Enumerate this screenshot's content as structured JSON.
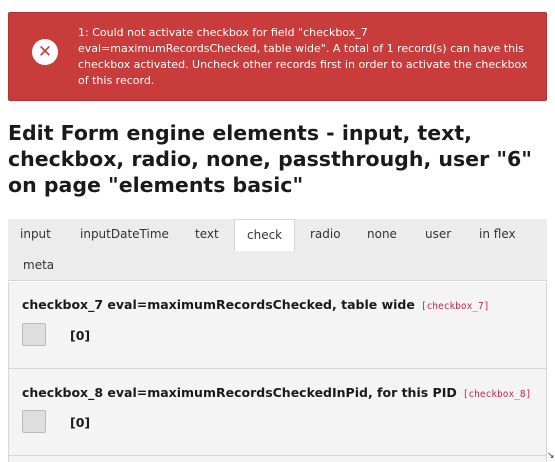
{
  "alert": {
    "icon": "close-circle-icon",
    "message": "1: Could not activate checkbox for field \"checkbox_7 eval=maximumRecordsChecked, table wide\". A total of 1 record(s) can have this checkbox activated. Uncheck other records first in order to activate the checkbox of this record.",
    "color": "#c83c3c"
  },
  "page_title": "Edit Form engine elements - input, text, checkbox, radio, none, passthrough, user \"6\" on page \"elements basic\"",
  "tabs": [
    {
      "label": "input"
    },
    {
      "label": "inputDateTime"
    },
    {
      "label": "text"
    },
    {
      "label": "check",
      "active": true
    },
    {
      "label": "radio"
    },
    {
      "label": "none"
    },
    {
      "label": "user"
    },
    {
      "label": "in flex"
    },
    {
      "label": "meta"
    }
  ],
  "fields": [
    {
      "label": "checkbox_7 eval=maximumRecordsChecked, table wide",
      "code": "[checkbox_7]",
      "value": "[0]",
      "checked": false
    },
    {
      "label": "checkbox_8 eval=maximumRecordsCheckedInPid, for this PID",
      "code": "[checkbox_8]",
      "value": "[0]",
      "checked": false
    }
  ],
  "code_color": "#c7254e"
}
